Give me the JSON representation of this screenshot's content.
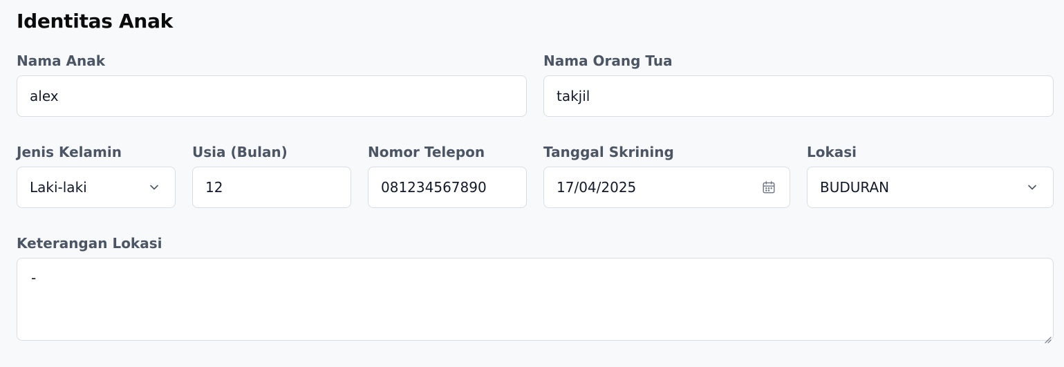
{
  "section": {
    "title": "Identitas Anak"
  },
  "fields": {
    "nama_anak": {
      "label": "Nama Anak",
      "value": "alex"
    },
    "nama_orang_tua": {
      "label": "Nama Orang Tua",
      "value": "takjil"
    },
    "jenis_kelamin": {
      "label": "Jenis Kelamin",
      "value": "Laki-laki",
      "icon": "chevron-down-icon"
    },
    "usia": {
      "label": "Usia (Bulan)",
      "value": "12"
    },
    "nomor_telepon": {
      "label": "Nomor Telepon",
      "value": "081234567890"
    },
    "tanggal_skrining": {
      "label": "Tanggal Skrining",
      "value": "17/04/2025",
      "icon": "calendar-icon"
    },
    "lokasi": {
      "label": "Lokasi",
      "value": "BUDURAN",
      "icon": "chevron-down-icon"
    },
    "keterangan_lokasi": {
      "label": "Keterangan Lokasi",
      "value": "-"
    }
  },
  "colors": {
    "page_background": "#f8f9fb",
    "input_border": "#d9dde3",
    "label_text": "#4b5563",
    "value_text": "#111827"
  }
}
